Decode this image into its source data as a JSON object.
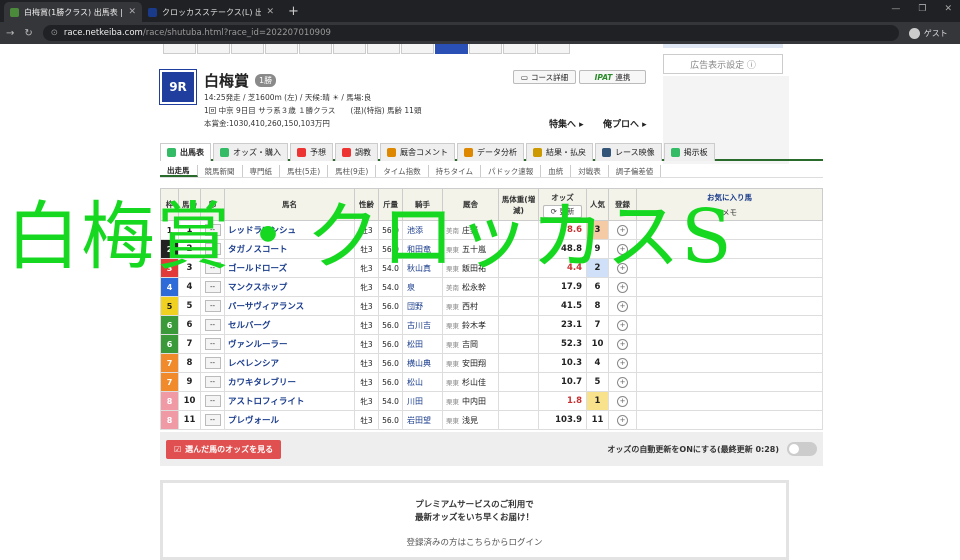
{
  "browser": {
    "tabs": [
      {
        "title": "白梅賞(1勝クラス) 出馬表 | 2022年",
        "active": true
      },
      {
        "title": "クロッカスステークス(L) 出馬表 | 2022",
        "active": false
      }
    ],
    "new_tab": "+",
    "url_host": "race.netkeiba.com",
    "url_path": "/race/shutuba.html?race_id=202207010909",
    "profile_label": "ゲスト"
  },
  "race": {
    "number": "9R",
    "name": "白梅賞",
    "grade": "1勝",
    "line1": "14:25発走 / 芝1600m (左) / 天候:晴 ☀ / 馬場:良",
    "line2": "1回 中京 9日目 サラ系３歳 １勝クラス　　(混)(特指) 馬齢 11頭",
    "line3": "本賞金:1030,410,260,150,103万円"
  },
  "buttons": {
    "course": "コース詳細",
    "ipat_brand": "IPAT",
    "ipat": "連携",
    "special": "特集へ",
    "pro": "俺プロへ",
    "ad": "広告表示設定 ⓘ"
  },
  "tabs": [
    "出馬表",
    "オッズ・購入",
    "予想",
    "調教",
    "厩舎コメント",
    "データ分析",
    "結果・払戻",
    "レース映像",
    "掲示板"
  ],
  "subtabs": [
    "出走馬",
    "競馬新聞",
    "専門紙",
    "馬柱(5走)",
    "馬柱(9走)",
    "タイム指数",
    "持ちタイム",
    "パドック速報",
    "血統",
    "対戦表",
    "調子偏差値"
  ],
  "columns": {
    "waku": "枠",
    "uma": "馬番",
    "mark": "印",
    "name": "馬名",
    "sex": "性齢",
    "kin": "斤量",
    "jockey": "騎手",
    "trainer": "厩舎",
    "weight": "馬体重(増減)",
    "odds": "オッズ",
    "odds_update": "更新",
    "pop": "人気",
    "fav": "登録",
    "favorites": "お気に入り馬",
    "memo": "メモ"
  },
  "entries": [
    {
      "waku": "1",
      "uma": "1",
      "mark": "--",
      "name": "レッドラマンシュ",
      "sex": "牡3",
      "kin": "56.0",
      "jockey": "池添",
      "stable": "美南",
      "trainer": "庄野",
      "odds": "8.6",
      "pop": "3",
      "wcolor": "#ffffff",
      "odds_red": true
    },
    {
      "waku": "2",
      "uma": "2",
      "mark": "--",
      "name": "タガノスコート",
      "sex": "牡3",
      "kin": "56.0",
      "jockey": "和田竜",
      "stable": "栗東",
      "trainer": "五十嵐",
      "odds": "48.8",
      "pop": "9",
      "wcolor": "#222222",
      "odds_red": false
    },
    {
      "waku": "3",
      "uma": "3",
      "mark": "--",
      "name": "ゴールドローズ",
      "sex": "牝3",
      "kin": "54.0",
      "jockey": "秋山真",
      "stable": "栗東",
      "trainer": "飯田祐",
      "odds": "4.4",
      "pop": "2",
      "wcolor": "#e23a3a",
      "odds_red": true
    },
    {
      "waku": "4",
      "uma": "4",
      "mark": "--",
      "name": "マンクスホップ",
      "sex": "牝3",
      "kin": "54.0",
      "jockey": "泉",
      "stable": "美南",
      "trainer": "松永幹",
      "odds": "17.9",
      "pop": "6",
      "wcolor": "#2f6bd8",
      "odds_red": false
    },
    {
      "waku": "5",
      "uma": "5",
      "mark": "--",
      "name": "バーサヴィアランス",
      "sex": "牡3",
      "kin": "56.0",
      "jockey": "団野",
      "stable": "栗東",
      "trainer": "西村",
      "odds": "41.5",
      "pop": "8",
      "wcolor": "#f0d020",
      "odds_red": false
    },
    {
      "waku": "6",
      "uma": "6",
      "mark": "--",
      "name": "セルバーグ",
      "sex": "牡3",
      "kin": "56.0",
      "jockey": "古川吉",
      "stable": "栗東",
      "trainer": "鈴木孝",
      "odds": "23.1",
      "pop": "7",
      "wcolor": "#3a9a3a",
      "odds_red": false
    },
    {
      "waku": "6",
      "uma": "7",
      "mark": "--",
      "name": "ヴァンルーラー",
      "sex": "牡3",
      "kin": "56.0",
      "jockey": "松田",
      "stable": "栗東",
      "trainer": "吉岡",
      "odds": "52.3",
      "pop": "10",
      "wcolor": "#3a9a3a",
      "odds_red": false
    },
    {
      "waku": "7",
      "uma": "8",
      "mark": "--",
      "name": "レベレンシア",
      "sex": "牡3",
      "kin": "56.0",
      "jockey": "横山典",
      "stable": "栗東",
      "trainer": "安田翔",
      "odds": "10.3",
      "pop": "4",
      "wcolor": "#f08a2a",
      "odds_red": false
    },
    {
      "waku": "7",
      "uma": "9",
      "mark": "--",
      "name": "カワキタレブリー",
      "sex": "牡3",
      "kin": "56.0",
      "jockey": "松山",
      "stable": "栗東",
      "trainer": "杉山佳",
      "odds": "10.7",
      "pop": "5",
      "wcolor": "#f08a2a",
      "odds_red": false
    },
    {
      "waku": "8",
      "uma": "10",
      "mark": "--",
      "name": "アストロフィライト",
      "sex": "牝3",
      "kin": "54.0",
      "jockey": "川田",
      "stable": "栗東",
      "trainer": "中内田",
      "odds": "1.8",
      "pop": "1",
      "wcolor": "#f09aa6",
      "odds_red": true
    },
    {
      "waku": "8",
      "uma": "11",
      "mark": "--",
      "name": "プレヴォール",
      "sex": "牡3",
      "kin": "56.0",
      "jockey": "岩田望",
      "stable": "栗東",
      "trainer": "浅見",
      "odds": "103.9",
      "pop": "11",
      "wcolor": "#f09aa6",
      "odds_red": false
    }
  ],
  "bottom": {
    "select_odds": "選んだ馬のオッズを見る",
    "auto_update": "オッズの自動更新をONにする(最終更新 0:28)"
  },
  "premium": {
    "line1": "プレミアムサービスのご利用で",
    "line2": "最新オッズをいち早くお届け！",
    "line3": "登録済みの方はこちらからログイン"
  },
  "overlay_title": "白梅賞・クロッカスS",
  "colors": {
    "accent_green": "#17d820",
    "race_blue": "#1f3e9e"
  }
}
